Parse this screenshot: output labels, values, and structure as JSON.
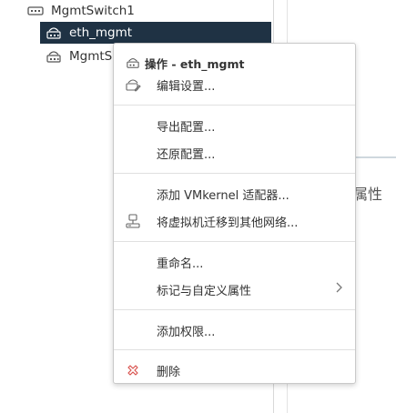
{
  "tree": {
    "switch_label": "MgmtSwitch1",
    "selected_portgroup_label": "eth_mgmt",
    "second_portgroup_label": "MgmtS"
  },
  "right_panel": {
    "partial_label": "属性"
  },
  "context_menu": {
    "header": "操作 - eth_mgmt",
    "edit_settings": "编辑设置...",
    "export_config": "导出配置...",
    "restore_config": "还原配置...",
    "add_vmkernel": "添加 VMkernel 适配器...",
    "migrate_vms": "将虚拟机迁移到其他网络...",
    "rename": "重命名...",
    "tags_attributes": "标记与自定义属性",
    "add_permission": "添加权限...",
    "delete": "删除"
  },
  "colors": {
    "selection_bg": "#1f3244",
    "delete_icon": "#d9534f"
  }
}
